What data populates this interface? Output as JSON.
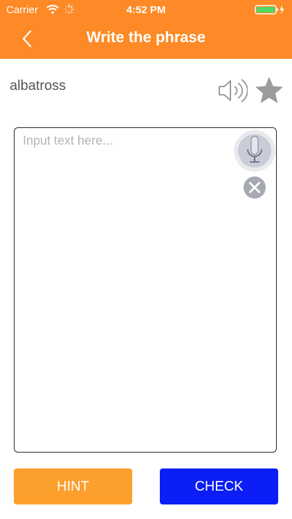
{
  "status_bar": {
    "carrier": "Carrier",
    "time": "4:52 PM"
  },
  "header": {
    "title": "Write the phrase",
    "back_icon": "chevron-left-icon"
  },
  "phrase": {
    "text": "albatross",
    "speaker_icon": "speaker-icon",
    "favorite_icon": "star-icon"
  },
  "input": {
    "placeholder": "Input text here...",
    "value": "",
    "mic_icon": "microphone-icon",
    "clear_icon": "clear-icon"
  },
  "buttons": {
    "hint_label": "HINT",
    "check_label": "CHECK"
  },
  "colors": {
    "header_bg": "#fd8a26",
    "hint_bg": "#fd9f2c",
    "check_bg": "#0a1ef5",
    "battery": "#4cd964"
  }
}
